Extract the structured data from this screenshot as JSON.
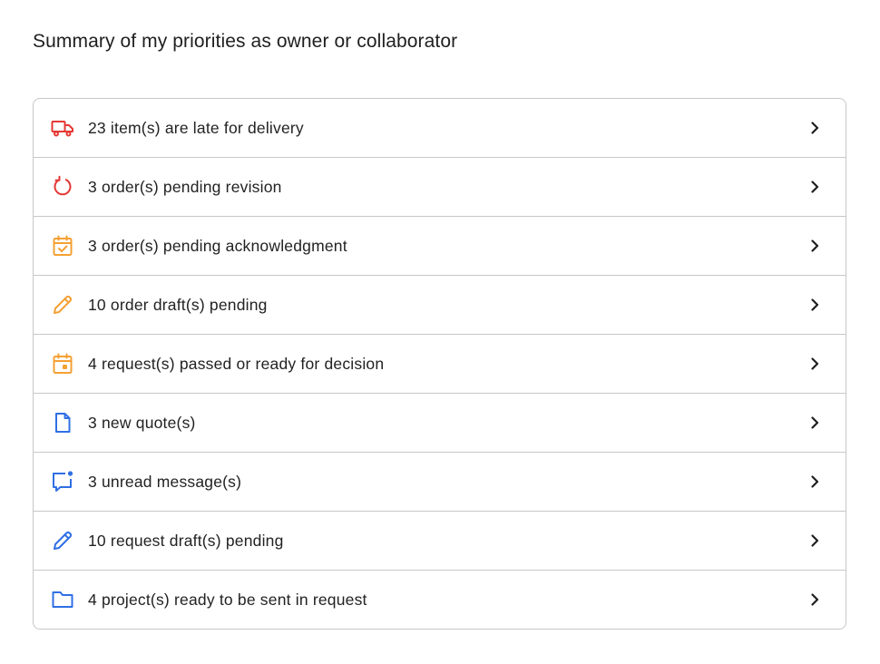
{
  "page": {
    "title": "Summary of my priorities as owner or collaborator"
  },
  "colors": {
    "red": "#e53935",
    "orange": "#f5a033",
    "blue": "#2f6fe4",
    "border": "#c7c7c7",
    "chevron": "#1f1f1f"
  },
  "priorities": [
    {
      "label": "23 item(s) are late for delivery",
      "icon": "truck-icon",
      "color": "red"
    },
    {
      "label": "3 order(s) pending revision",
      "icon": "refresh-icon",
      "color": "red"
    },
    {
      "label": "3 order(s) pending acknowledgment",
      "icon": "calendar-check-icon",
      "color": "orange"
    },
    {
      "label": "10 order draft(s) pending",
      "icon": "pencil-icon",
      "color": "orange"
    },
    {
      "label": "4 request(s) passed or ready for decision",
      "icon": "calendar-event-icon",
      "color": "orange"
    },
    {
      "label": "3 new quote(s)",
      "icon": "document-icon",
      "color": "blue"
    },
    {
      "label": "3 unread message(s)",
      "icon": "chat-unread-icon",
      "color": "blue"
    },
    {
      "label": "10 request draft(s) pending",
      "icon": "pencil-icon",
      "color": "blue"
    },
    {
      "label": "4 project(s) ready to be sent in request",
      "icon": "folder-icon",
      "color": "blue"
    }
  ]
}
